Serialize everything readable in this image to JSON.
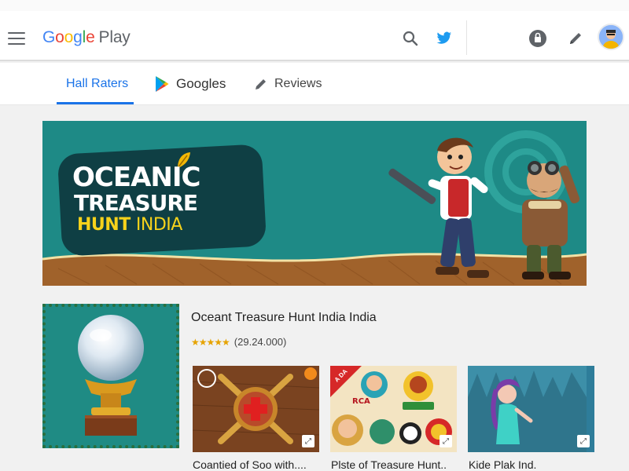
{
  "header": {
    "logo": {
      "g1": "G",
      "o1": "o",
      "o2": "o",
      "g2": "g",
      "l": "l",
      "e": "e",
      "play": "Play"
    },
    "icons": [
      "menu-icon",
      "search-icon",
      "twitter-bird-icon",
      "lock-icon",
      "edit-pencil-icon",
      "user-avatar"
    ]
  },
  "tabs": [
    {
      "label": "Hall Raters",
      "active": true
    },
    {
      "label": "Googles",
      "icon": "play-triangle-icon"
    },
    {
      "label": "Reviews",
      "icon": "pencil-icon"
    }
  ],
  "banner": {
    "line1": "OCEANIC",
    "line2": "TREASURE",
    "line3_bold": "HUNT",
    "line3_thin": "INDIA"
  },
  "app": {
    "title": "Oceant Treasure Hunt India India",
    "stars": "★★★★★",
    "rating_count": "(29.24.000)",
    "rating_stars": 5
  },
  "screenshots": [
    {
      "caption": "Coantied of Soo with...."
    },
    {
      "caption": "Plste of Treasure Hunt..",
      "tag": "RCA",
      "ribbon": "A DA"
    },
    {
      "caption": "Kide Plak Ind."
    }
  ],
  "colors": {
    "accent": "#1a73e8",
    "banner_bg": "#1e8a86",
    "plate": "#0f3f44",
    "gold": "#f6d21b"
  }
}
